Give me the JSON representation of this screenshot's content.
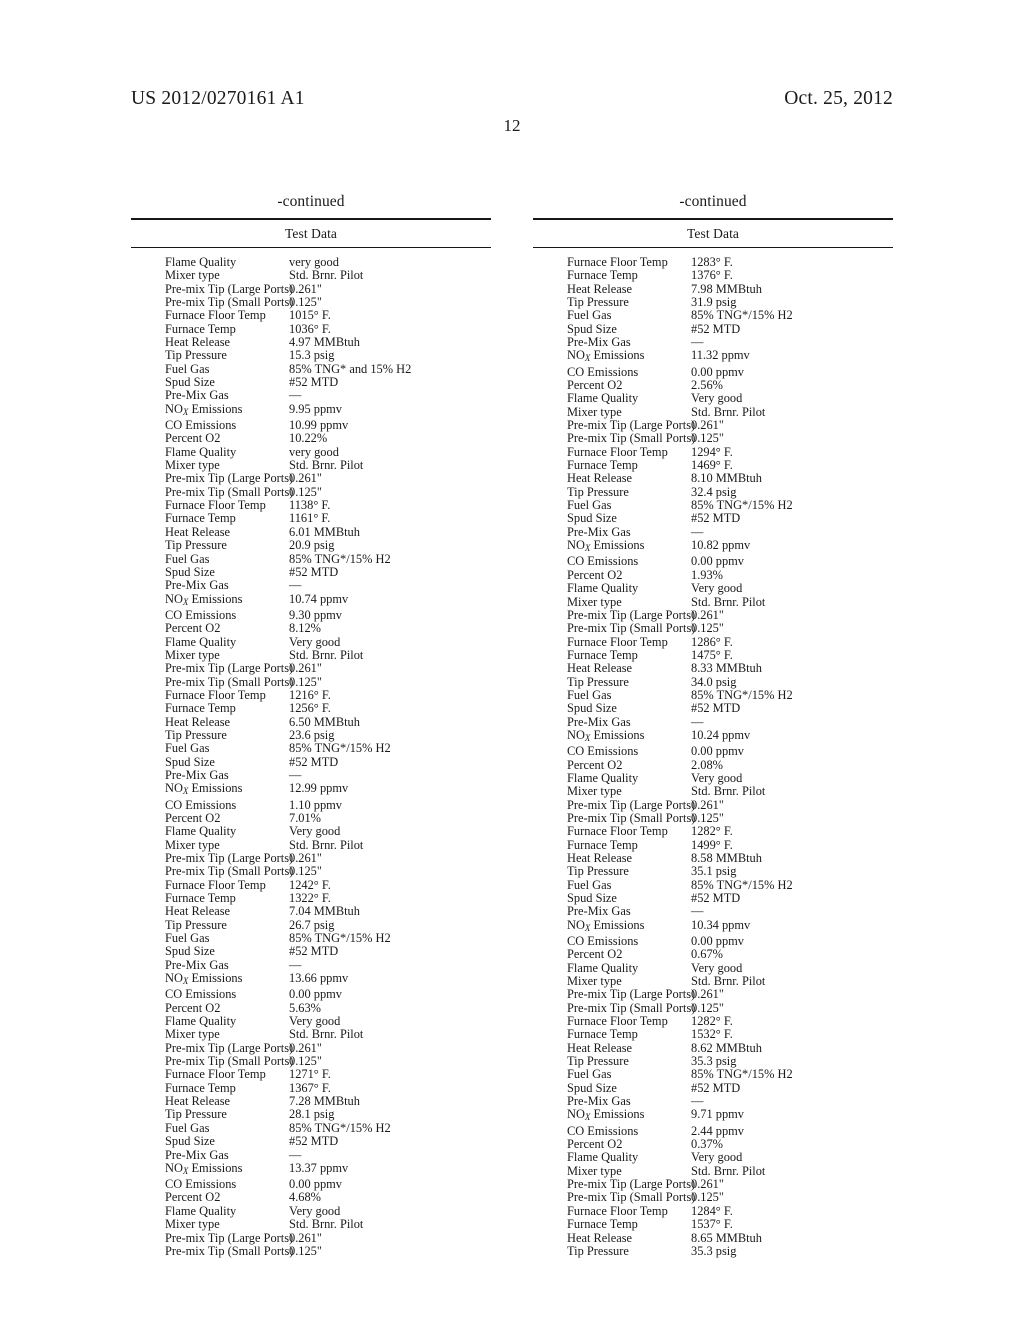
{
  "header": {
    "publication_number": "US 2012/0270161 A1",
    "publication_date": "Oct. 25, 2012",
    "page_number": "12"
  },
  "columns": [
    {
      "continued_label": "-continued",
      "caption": "Test Data",
      "rows": [
        {
          "label": "Flame Quality",
          "value": "very good"
        },
        {
          "label": "Mixer type",
          "value": "Std. Brnr. Pilot"
        },
        {
          "label": "Pre-mix Tip (Large Ports)",
          "value": "0.261\""
        },
        {
          "label": "Pre-mix Tip (Small Ports)",
          "value": "0.125\""
        },
        {
          "label": "Furnace Floor Temp",
          "value": "1015° F."
        },
        {
          "label": "Furnace Temp",
          "value": "1036° F."
        },
        {
          "label": "Heat Release",
          "value": "4.97 MMBtuh"
        },
        {
          "label": "Tip Pressure",
          "value": "15.3 psig"
        },
        {
          "label": "Fuel Gas",
          "value": "85% TNG* and 15% H2"
        },
        {
          "label": "Spud Size",
          "value": "#52 MTD"
        },
        {
          "label": "Pre-Mix Gas",
          "value": "—"
        },
        {
          "label": "NOX Emissions",
          "value": "9.95 ppmv",
          "nox": true
        },
        {
          "label": "CO Emissions",
          "value": "10.99 ppmv"
        },
        {
          "label": "Percent O2",
          "value": "10.22%"
        },
        {
          "label": "Flame Quality",
          "value": "very good"
        },
        {
          "label": "Mixer type",
          "value": "Std. Brnr. Pilot"
        },
        {
          "label": "Pre-mix Tip (Large Ports)",
          "value": "0.261\""
        },
        {
          "label": "Pre-mix Tip (Small Ports)",
          "value": "0.125\""
        },
        {
          "label": "Furnace Floor Temp",
          "value": "1138° F."
        },
        {
          "label": "Furnace Temp",
          "value": "1161° F."
        },
        {
          "label": "Heat Release",
          "value": "6.01 MMBtuh"
        },
        {
          "label": "Tip Pressure",
          "value": "20.9 psig"
        },
        {
          "label": "Fuel Gas",
          "value": "85% TNG*/15% H2"
        },
        {
          "label": "Spud Size",
          "value": "#52 MTD"
        },
        {
          "label": "Pre-Mix Gas",
          "value": "—"
        },
        {
          "label": "NOX Emissions",
          "value": "10.74 ppmv",
          "nox": true
        },
        {
          "label": "CO Emissions",
          "value": "9.30 ppmv"
        },
        {
          "label": "Percent O2",
          "value": "8.12%"
        },
        {
          "label": "Flame Quality",
          "value": "Very good"
        },
        {
          "label": "Mixer type",
          "value": "Std. Brnr. Pilot"
        },
        {
          "label": "Pre-mix Tip (Large Ports)",
          "value": "0.261\""
        },
        {
          "label": "Pre-mix Tip (Small Ports)",
          "value": "0.125\""
        },
        {
          "label": "Furnace Floor Temp",
          "value": "1216° F."
        },
        {
          "label": "Furnace Temp",
          "value": "1256° F."
        },
        {
          "label": "Heat Release",
          "value": "6.50 MMBtuh"
        },
        {
          "label": "Tip Pressure",
          "value": "23.6 psig"
        },
        {
          "label": "Fuel Gas",
          "value": "85% TNG*/15% H2"
        },
        {
          "label": "Spud Size",
          "value": "#52 MTD"
        },
        {
          "label": "Pre-Mix Gas",
          "value": "—"
        },
        {
          "label": "NOX Emissions",
          "value": "12.99 ppmv",
          "nox": true
        },
        {
          "label": "CO Emissions",
          "value": "1.10 ppmv"
        },
        {
          "label": "Percent O2",
          "value": "7.01%"
        },
        {
          "label": "Flame Quality",
          "value": "Very good"
        },
        {
          "label": "Mixer type",
          "value": "Std. Brnr. Pilot"
        },
        {
          "label": "Pre-mix Tip (Large Ports)",
          "value": "0.261\""
        },
        {
          "label": "Pre-mix Tip (Small Ports)",
          "value": "0.125\""
        },
        {
          "label": "Furnace Floor Temp",
          "value": "1242° F."
        },
        {
          "label": "Furnace Temp",
          "value": "1322° F."
        },
        {
          "label": "Heat Release",
          "value": "7.04 MMBtuh"
        },
        {
          "label": "Tip Pressure",
          "value": "26.7 psig"
        },
        {
          "label": "Fuel Gas",
          "value": "85% TNG*/15% H2"
        },
        {
          "label": "Spud Size",
          "value": "#52 MTD"
        },
        {
          "label": "Pre-Mix Gas",
          "value": "—"
        },
        {
          "label": "NOX Emissions",
          "value": "13.66 ppmv",
          "nox": true
        },
        {
          "label": "CO Emissions",
          "value": "0.00 ppmv"
        },
        {
          "label": "Percent O2",
          "value": "5.63%"
        },
        {
          "label": "Flame Quality",
          "value": "Very good"
        },
        {
          "label": "Mixer type",
          "value": "Std. Brnr. Pilot"
        },
        {
          "label": "Pre-mix Tip (Large Ports)",
          "value": "0.261\""
        },
        {
          "label": "Pre-mix Tip (Small Ports)",
          "value": "0.125\""
        },
        {
          "label": "Furnace Floor Temp",
          "value": "1271° F."
        },
        {
          "label": "Furnace Temp",
          "value": "1367° F."
        },
        {
          "label": "Heat Release",
          "value": "7.28 MMBtuh"
        },
        {
          "label": "Tip Pressure",
          "value": "28.1 psig"
        },
        {
          "label": "Fuel Gas",
          "value": "85% TNG*/15% H2"
        },
        {
          "label": "Spud Size",
          "value": "#52 MTD"
        },
        {
          "label": "Pre-Mix Gas",
          "value": "—"
        },
        {
          "label": "NOX Emissions",
          "value": "13.37 ppmv",
          "nox": true
        },
        {
          "label": "CO Emissions",
          "value": "0.00 ppmv"
        },
        {
          "label": "Percent O2",
          "value": "4.68%"
        },
        {
          "label": "Flame Quality",
          "value": "Very good"
        },
        {
          "label": "Mixer type",
          "value": "Std. Brnr. Pilot"
        },
        {
          "label": "Pre-mix Tip (Large Ports)",
          "value": "0.261\""
        },
        {
          "label": "Pre-mix Tip (Small Ports)",
          "value": "0.125\""
        }
      ]
    },
    {
      "continued_label": "-continued",
      "caption": "Test Data",
      "rows": [
        {
          "label": "Furnace Floor Temp",
          "value": "1283° F."
        },
        {
          "label": "Furnace Temp",
          "value": "1376° F."
        },
        {
          "label": "Heat Release",
          "value": "7.98 MMBtuh"
        },
        {
          "label": "Tip Pressure",
          "value": "31.9 psig"
        },
        {
          "label": "Fuel Gas",
          "value": "85% TNG*/15% H2"
        },
        {
          "label": "Spud Size",
          "value": "#52 MTD"
        },
        {
          "label": "Pre-Mix Gas",
          "value": "—"
        },
        {
          "label": "NOX Emissions",
          "value": "11.32 ppmv",
          "nox": true
        },
        {
          "label": "CO Emissions",
          "value": "0.00 ppmv"
        },
        {
          "label": "Percent O2",
          "value": "2.56%"
        },
        {
          "label": "Flame Quality",
          "value": "Very good"
        },
        {
          "label": "Mixer type",
          "value": "Std. Brnr. Pilot"
        },
        {
          "label": "Pre-mix Tip (Large Ports)",
          "value": "0.261\""
        },
        {
          "label": "Pre-mix Tip (Small Ports)",
          "value": "0.125\""
        },
        {
          "label": "Furnace Floor Temp",
          "value": "1294° F."
        },
        {
          "label": "Furnace Temp",
          "value": "1469° F."
        },
        {
          "label": "Heat Release",
          "value": "8.10 MMBtuh"
        },
        {
          "label": "Tip Pressure",
          "value": "32.4 psig"
        },
        {
          "label": "Fuel Gas",
          "value": "85% TNG*/15% H2"
        },
        {
          "label": "Spud Size",
          "value": "#52 MTD"
        },
        {
          "label": "Pre-Mix Gas",
          "value": "—"
        },
        {
          "label": "NOX Emissions",
          "value": "10.82 ppmv",
          "nox": true
        },
        {
          "label": "CO Emissions",
          "value": "0.00 ppmv"
        },
        {
          "label": "Percent O2",
          "value": "1.93%"
        },
        {
          "label": "Flame Quality",
          "value": "Very good"
        },
        {
          "label": "Mixer type",
          "value": "Std. Brnr. Pilot"
        },
        {
          "label": "Pre-mix Tip (Large Ports)",
          "value": "0.261\""
        },
        {
          "label": "Pre-mix Tip (Small Ports)",
          "value": "0.125\""
        },
        {
          "label": "Furnace Floor Temp",
          "value": "1286° F."
        },
        {
          "label": "Furnace Temp",
          "value": "1475° F."
        },
        {
          "label": "Heat Release",
          "value": "8.33 MMBtuh"
        },
        {
          "label": "Tip Pressure",
          "value": "34.0 psig"
        },
        {
          "label": "Fuel Gas",
          "value": "85% TNG*/15% H2"
        },
        {
          "label": "Spud Size",
          "value": "#52 MTD"
        },
        {
          "label": "Pre-Mix Gas",
          "value": "—"
        },
        {
          "label": "NOX Emissions",
          "value": "10.24 ppmv",
          "nox": true
        },
        {
          "label": "CO Emissions",
          "value": "0.00 ppmv"
        },
        {
          "label": "Percent O2",
          "value": "2.08%"
        },
        {
          "label": "Flame Quality",
          "value": "Very good"
        },
        {
          "label": "Mixer type",
          "value": "Std. Brnr. Pilot"
        },
        {
          "label": "Pre-mix Tip (Large Ports)",
          "value": "0.261\""
        },
        {
          "label": "Pre-mix Tip (Small Ports)",
          "value": "0.125\""
        },
        {
          "label": "Furnace Floor Temp",
          "value": "1282° F."
        },
        {
          "label": "Furnace Temp",
          "value": "1499° F."
        },
        {
          "label": "Heat Release",
          "value": "8.58 MMBtuh"
        },
        {
          "label": "Tip Pressure",
          "value": "35.1 psig"
        },
        {
          "label": "Fuel Gas",
          "value": "85% TNG*/15% H2"
        },
        {
          "label": "Spud Size",
          "value": "#52 MTD"
        },
        {
          "label": "Pre-Mix Gas",
          "value": "—"
        },
        {
          "label": "NOX Emissions",
          "value": "10.34 ppmv",
          "nox": true
        },
        {
          "label": "CO Emissions",
          "value": "0.00 ppmv"
        },
        {
          "label": "Percent O2",
          "value": "0.67%"
        },
        {
          "label": "Flame Quality",
          "value": "Very good"
        },
        {
          "label": "Mixer type",
          "value": "Std. Brnr. Pilot"
        },
        {
          "label": "Pre-mix Tip (Large Ports)",
          "value": "0.261\""
        },
        {
          "label": "Pre-mix Tip (Small Ports)",
          "value": "0.125\""
        },
        {
          "label": "Furnace Floor Temp",
          "value": "1282° F."
        },
        {
          "label": "Furnace Temp",
          "value": "1532° F."
        },
        {
          "label": "Heat Release",
          "value": "8.62 MMBtuh"
        },
        {
          "label": "Tip Pressure",
          "value": "35.3 psig"
        },
        {
          "label": "Fuel Gas",
          "value": "85% TNG*/15% H2"
        },
        {
          "label": "Spud Size",
          "value": "#52 MTD"
        },
        {
          "label": "Pre-Mix Gas",
          "value": "—"
        },
        {
          "label": "NOX Emissions",
          "value": "9.71 ppmv",
          "nox": true
        },
        {
          "label": "CO Emissions",
          "value": "2.44 ppmv"
        },
        {
          "label": "Percent O2",
          "value": "0.37%"
        },
        {
          "label": "Flame Quality",
          "value": "Very good"
        },
        {
          "label": "Mixer type",
          "value": "Std. Brnr. Pilot"
        },
        {
          "label": "Pre-mix Tip (Large Ports)",
          "value": "0.261\""
        },
        {
          "label": "Pre-mix Tip (Small Ports)",
          "value": "0.125\""
        },
        {
          "label": "Furnace Floor Temp",
          "value": "1284° F."
        },
        {
          "label": "Furnace Temp",
          "value": "1537° F."
        },
        {
          "label": "Heat Release",
          "value": "8.65 MMBtuh"
        },
        {
          "label": "Tip Pressure",
          "value": "35.3 psig"
        }
      ]
    }
  ]
}
